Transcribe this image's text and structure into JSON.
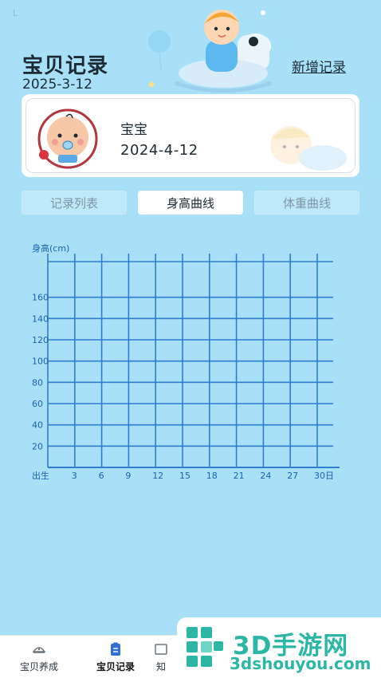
{
  "status_bar": {
    "mark": "L"
  },
  "header": {
    "title": "宝贝记录",
    "date": "2025-3-12",
    "add_record_label": "新增记录"
  },
  "baby": {
    "name": "宝宝",
    "birth_date": "2024-4-12"
  },
  "tabs": [
    {
      "label": "记录列表",
      "active": false
    },
    {
      "label": "身高曲线",
      "active": true
    },
    {
      "label": "体重曲线",
      "active": false
    }
  ],
  "chart_data": {
    "type": "line",
    "ylabel": "身高(cm)",
    "xlabel": "",
    "y_ticks": [
      20,
      40,
      60,
      80,
      100,
      120,
      140,
      160
    ],
    "x_ticks": [
      "出生",
      "3",
      "6",
      "9",
      "12",
      "15",
      "18",
      "21",
      "24",
      "27",
      "30日"
    ],
    "ylim": [
      0,
      180
    ],
    "grid": true,
    "series": []
  },
  "bottom_nav": [
    {
      "label": "宝贝养成",
      "active": false,
      "icon": "baby-icon"
    },
    {
      "label": "宝贝记录",
      "active": true,
      "icon": "clipboard-icon"
    },
    {
      "label": "知",
      "active": false,
      "icon": "book-icon"
    }
  ],
  "watermark": {
    "title": "3D手游网",
    "subtitle": "3dshouyou.com"
  },
  "colors": {
    "background": "#a8e1f7",
    "grid": "#2f7dd1",
    "watermark": "#2bb6a6"
  }
}
